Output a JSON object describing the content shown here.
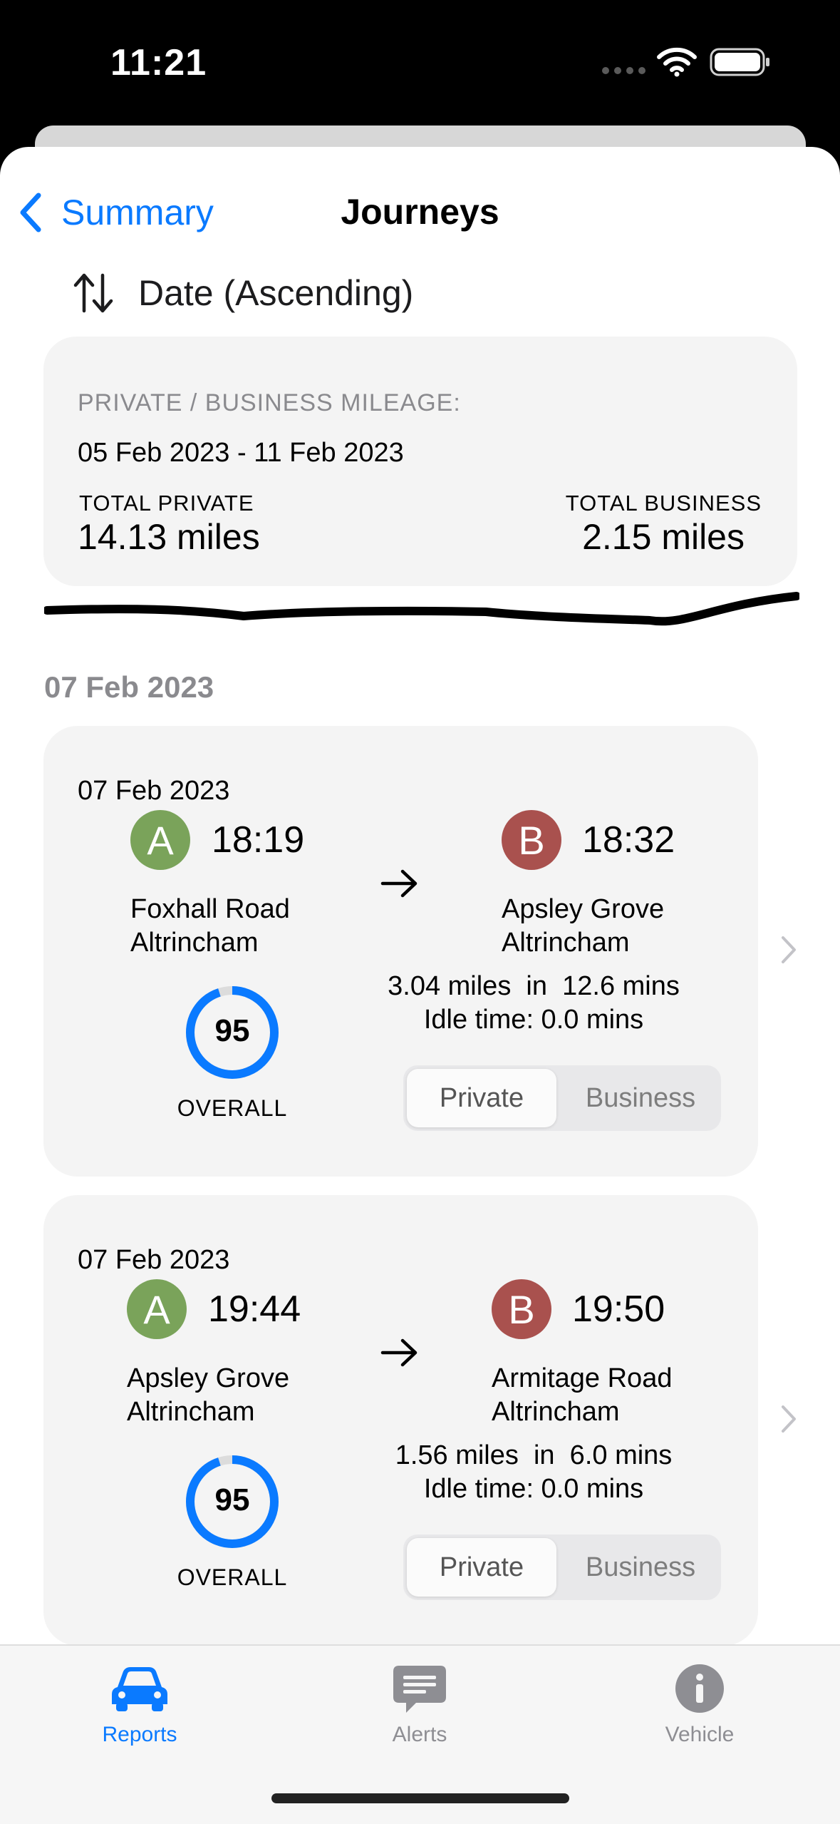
{
  "status_bar": {
    "time": "11:21"
  },
  "nav": {
    "back_label": "Summary",
    "title": "Journeys"
  },
  "sort": {
    "label": "Date (Ascending)"
  },
  "summary": {
    "heading": "PRIVATE / BUSINESS MILEAGE:",
    "date_range": "05 Feb 2023 - 11 Feb 2023",
    "total_private_label": "TOTAL PRIVATE",
    "total_private_value": "14.13 miles",
    "total_business_label": "TOTAL BUSINESS",
    "total_business_value": "2.15 miles"
  },
  "section": {
    "header": "07 Feb 2023"
  },
  "journeys": [
    {
      "date": "07 Feb 2023",
      "start": {
        "badge": "A",
        "time": "18:19",
        "street": "Foxhall Road",
        "town": "Altrincham"
      },
      "end": {
        "badge": "B",
        "time": "18:32",
        "street": "Apsley Grove",
        "town": "Altrincham"
      },
      "distance_line": "3.04 miles  in  12.6 mins",
      "idle_line": "Idle time: 0.0 mins",
      "score": "95",
      "score_fraction": 0.95,
      "score_label": "OVERALL",
      "segment": {
        "private": "Private",
        "business": "Business",
        "selected": "Private"
      }
    },
    {
      "date": "07 Feb 2023",
      "start": {
        "badge": "A",
        "time": "19:44",
        "street": "Apsley Grove",
        "town": "Altrincham"
      },
      "end": {
        "badge": "B",
        "time": "19:50",
        "street": "Armitage Road",
        "town": "Altrincham"
      },
      "distance_line": "1.56 miles  in  6.0 mins",
      "idle_line": "Idle time: 0.0 mins",
      "score": "95",
      "score_fraction": 0.95,
      "score_label": "OVERALL",
      "segment": {
        "private": "Private",
        "business": "Business",
        "selected": "Private"
      }
    }
  ],
  "tab_bar": {
    "items": [
      {
        "label": "Reports",
        "icon": "car-icon",
        "selected": true
      },
      {
        "label": "Alerts",
        "icon": "message-icon",
        "selected": false
      },
      {
        "label": "Vehicle",
        "icon": "info-icon",
        "selected": false
      }
    ]
  },
  "colors": {
    "accent": "#0a7aff",
    "badge_a": "#7aa35a",
    "badge_b": "#a9514e",
    "card_bg": "#f4f4f4",
    "inactive_tab": "#8e8e93"
  }
}
